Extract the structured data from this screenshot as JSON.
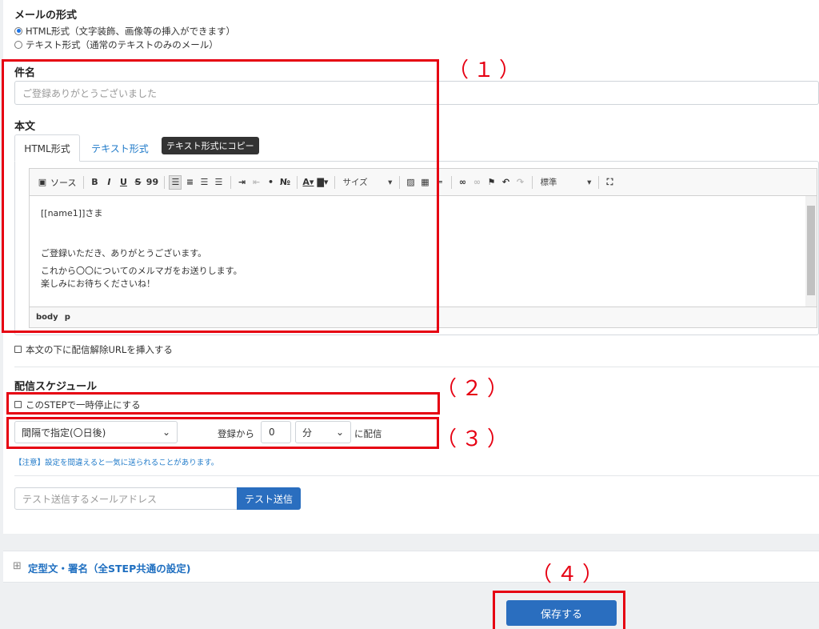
{
  "mail_format": {
    "heading": "メールの形式",
    "options": [
      {
        "label": "HTML形式（文字装飾、画像等の挿入ができます）",
        "selected": true
      },
      {
        "label": "テキスト形式（通常のテキストのみのメール）",
        "selected": false
      }
    ]
  },
  "subject": {
    "label": "件名",
    "placeholder": "ご登録ありがとうございました"
  },
  "body": {
    "label": "本文",
    "tabs": [
      "HTML形式",
      "テキスト形式"
    ],
    "copy_button": "テキスト形式にコピー",
    "toolbar": {
      "source": "ソース",
      "bold": "B",
      "italic": "I",
      "underline": "U",
      "strike": "S",
      "quote": "99",
      "size_combo": "サイズ",
      "format_combo": "標準"
    },
    "content_lines": [
      "[[name1]]さま",
      "",
      "",
      "ご登録いただき、ありがとうございます。",
      "",
      "これから〇〇についてのメルマガをお送りします。",
      "楽しみにお待ちくださいね！"
    ],
    "path": [
      "body",
      "p"
    ]
  },
  "unsubscribe_checkbox": "本文の下に配信解除URLを挿入する",
  "schedule": {
    "heading": "配信スケジュール",
    "pause_checkbox": "このSTEPで一時停止にする",
    "interval_select": "間隔で指定(〇日後)",
    "from_label": "登録から",
    "value": "0",
    "unit_select": "分",
    "deliver_label": "に配信",
    "note": "【注意】設定を間違えると一気に送られることがあります。"
  },
  "test_send": {
    "placeholder": "テスト送信するメールアドレス",
    "button": "テスト送信"
  },
  "template_section": {
    "toggle": "⊞",
    "title": "定型文・署名（全STEP共通の設定)"
  },
  "save_button": "保存する",
  "annotations": [
    "（１）",
    "（２）",
    "（３）",
    "（４）"
  ],
  "colors": {
    "accent": "#2a6ebf",
    "link": "#1f7ac9",
    "annotation_red": "#e60012"
  }
}
